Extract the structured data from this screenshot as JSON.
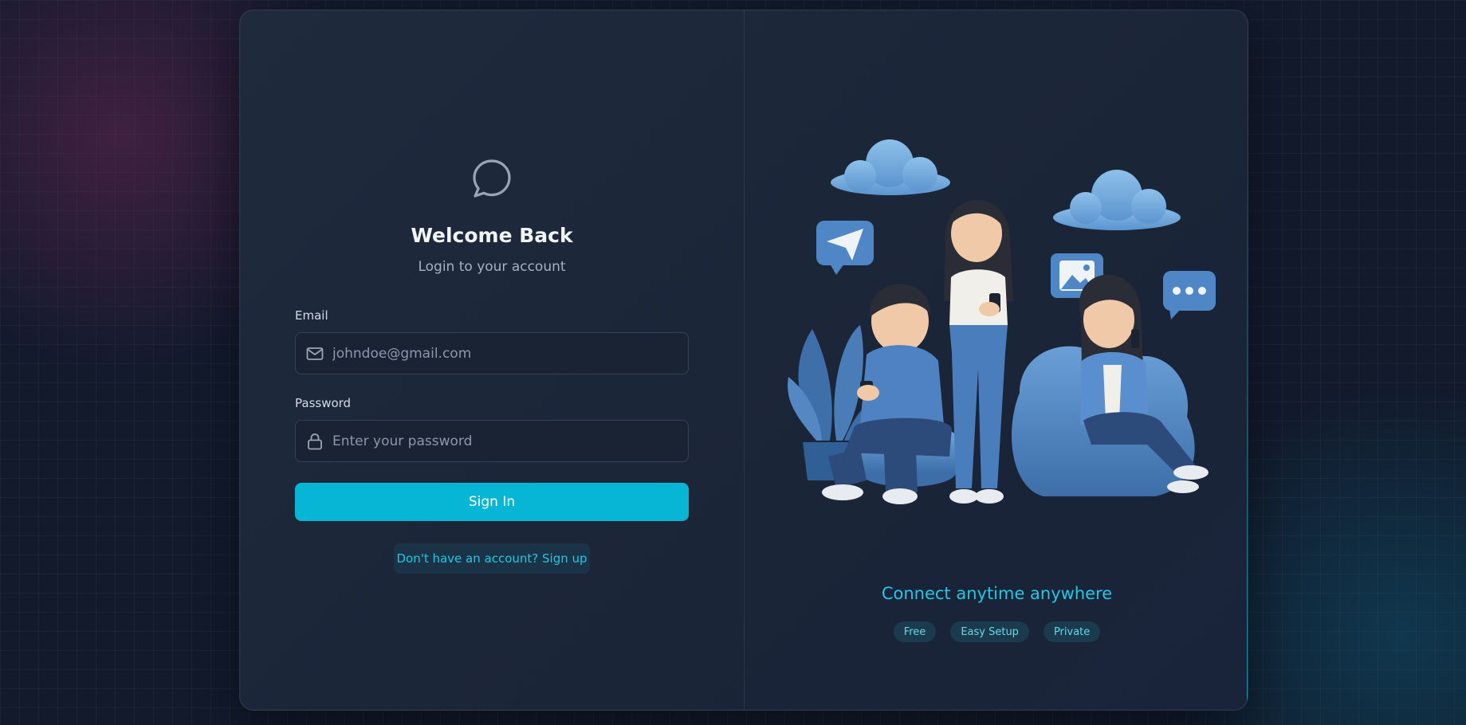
{
  "login": {
    "title": "Welcome Back",
    "subtitle": "Login to your account",
    "email_label": "Email",
    "email_placeholder": "johndoe@gmail.com",
    "password_label": "Password",
    "password_placeholder": "Enter your password",
    "signin_label": "Sign In",
    "signup_link": "Don't have an account? Sign up"
  },
  "promo": {
    "tagline": "Connect anytime anywhere",
    "chips": [
      "Free",
      "Easy Setup",
      "Private"
    ]
  },
  "icons": {
    "logo": "chat-bubble-icon",
    "email": "mail-icon",
    "password": "lock-icon"
  },
  "colors": {
    "accent": "#06b6d4",
    "accent_text": "#22c7e3",
    "card_bg": "#1e293b",
    "page_bg": "#121a2c"
  }
}
